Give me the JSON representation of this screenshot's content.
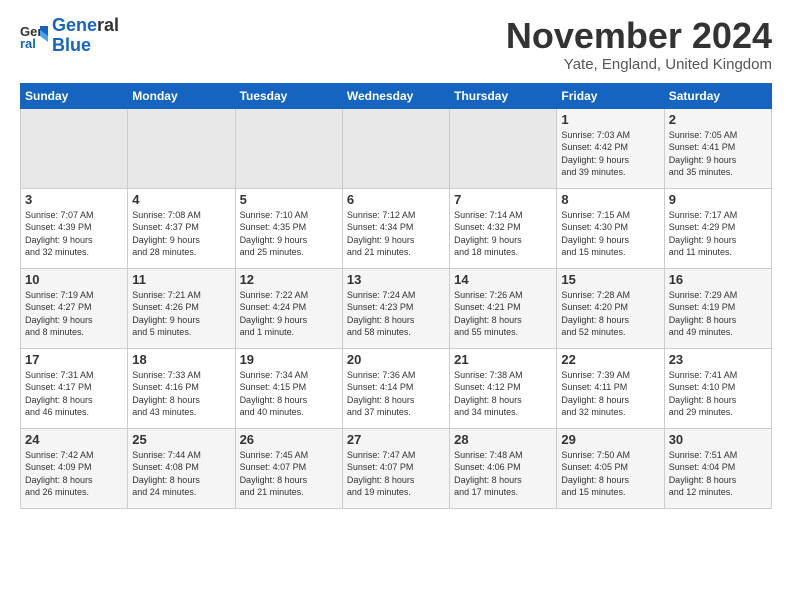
{
  "logo": {
    "line1": "General",
    "line2": "Blue"
  },
  "title": "November 2024",
  "location": "Yate, England, United Kingdom",
  "weekdays": [
    "Sunday",
    "Monday",
    "Tuesday",
    "Wednesday",
    "Thursday",
    "Friday",
    "Saturday"
  ],
  "weeks": [
    [
      {
        "day": "",
        "info": ""
      },
      {
        "day": "",
        "info": ""
      },
      {
        "day": "",
        "info": ""
      },
      {
        "day": "",
        "info": ""
      },
      {
        "day": "",
        "info": ""
      },
      {
        "day": "1",
        "info": "Sunrise: 7:03 AM\nSunset: 4:42 PM\nDaylight: 9 hours\nand 39 minutes."
      },
      {
        "day": "2",
        "info": "Sunrise: 7:05 AM\nSunset: 4:41 PM\nDaylight: 9 hours\nand 35 minutes."
      }
    ],
    [
      {
        "day": "3",
        "info": "Sunrise: 7:07 AM\nSunset: 4:39 PM\nDaylight: 9 hours\nand 32 minutes."
      },
      {
        "day": "4",
        "info": "Sunrise: 7:08 AM\nSunset: 4:37 PM\nDaylight: 9 hours\nand 28 minutes."
      },
      {
        "day": "5",
        "info": "Sunrise: 7:10 AM\nSunset: 4:35 PM\nDaylight: 9 hours\nand 25 minutes."
      },
      {
        "day": "6",
        "info": "Sunrise: 7:12 AM\nSunset: 4:34 PM\nDaylight: 9 hours\nand 21 minutes."
      },
      {
        "day": "7",
        "info": "Sunrise: 7:14 AM\nSunset: 4:32 PM\nDaylight: 9 hours\nand 18 minutes."
      },
      {
        "day": "8",
        "info": "Sunrise: 7:15 AM\nSunset: 4:30 PM\nDaylight: 9 hours\nand 15 minutes."
      },
      {
        "day": "9",
        "info": "Sunrise: 7:17 AM\nSunset: 4:29 PM\nDaylight: 9 hours\nand 11 minutes."
      }
    ],
    [
      {
        "day": "10",
        "info": "Sunrise: 7:19 AM\nSunset: 4:27 PM\nDaylight: 9 hours\nand 8 minutes."
      },
      {
        "day": "11",
        "info": "Sunrise: 7:21 AM\nSunset: 4:26 PM\nDaylight: 9 hours\nand 5 minutes."
      },
      {
        "day": "12",
        "info": "Sunrise: 7:22 AM\nSunset: 4:24 PM\nDaylight: 9 hours\nand 1 minute."
      },
      {
        "day": "13",
        "info": "Sunrise: 7:24 AM\nSunset: 4:23 PM\nDaylight: 8 hours\nand 58 minutes."
      },
      {
        "day": "14",
        "info": "Sunrise: 7:26 AM\nSunset: 4:21 PM\nDaylight: 8 hours\nand 55 minutes."
      },
      {
        "day": "15",
        "info": "Sunrise: 7:28 AM\nSunset: 4:20 PM\nDaylight: 8 hours\nand 52 minutes."
      },
      {
        "day": "16",
        "info": "Sunrise: 7:29 AM\nSunset: 4:19 PM\nDaylight: 8 hours\nand 49 minutes."
      }
    ],
    [
      {
        "day": "17",
        "info": "Sunrise: 7:31 AM\nSunset: 4:17 PM\nDaylight: 8 hours\nand 46 minutes."
      },
      {
        "day": "18",
        "info": "Sunrise: 7:33 AM\nSunset: 4:16 PM\nDaylight: 8 hours\nand 43 minutes."
      },
      {
        "day": "19",
        "info": "Sunrise: 7:34 AM\nSunset: 4:15 PM\nDaylight: 8 hours\nand 40 minutes."
      },
      {
        "day": "20",
        "info": "Sunrise: 7:36 AM\nSunset: 4:14 PM\nDaylight: 8 hours\nand 37 minutes."
      },
      {
        "day": "21",
        "info": "Sunrise: 7:38 AM\nSunset: 4:12 PM\nDaylight: 8 hours\nand 34 minutes."
      },
      {
        "day": "22",
        "info": "Sunrise: 7:39 AM\nSunset: 4:11 PM\nDaylight: 8 hours\nand 32 minutes."
      },
      {
        "day": "23",
        "info": "Sunrise: 7:41 AM\nSunset: 4:10 PM\nDaylight: 8 hours\nand 29 minutes."
      }
    ],
    [
      {
        "day": "24",
        "info": "Sunrise: 7:42 AM\nSunset: 4:09 PM\nDaylight: 8 hours\nand 26 minutes."
      },
      {
        "day": "25",
        "info": "Sunrise: 7:44 AM\nSunset: 4:08 PM\nDaylight: 8 hours\nand 24 minutes."
      },
      {
        "day": "26",
        "info": "Sunrise: 7:45 AM\nSunset: 4:07 PM\nDaylight: 8 hours\nand 21 minutes."
      },
      {
        "day": "27",
        "info": "Sunrise: 7:47 AM\nSunset: 4:07 PM\nDaylight: 8 hours\nand 19 minutes."
      },
      {
        "day": "28",
        "info": "Sunrise: 7:48 AM\nSunset: 4:06 PM\nDaylight: 8 hours\nand 17 minutes."
      },
      {
        "day": "29",
        "info": "Sunrise: 7:50 AM\nSunset: 4:05 PM\nDaylight: 8 hours\nand 15 minutes."
      },
      {
        "day": "30",
        "info": "Sunrise: 7:51 AM\nSunset: 4:04 PM\nDaylight: 8 hours\nand 12 minutes."
      }
    ]
  ]
}
